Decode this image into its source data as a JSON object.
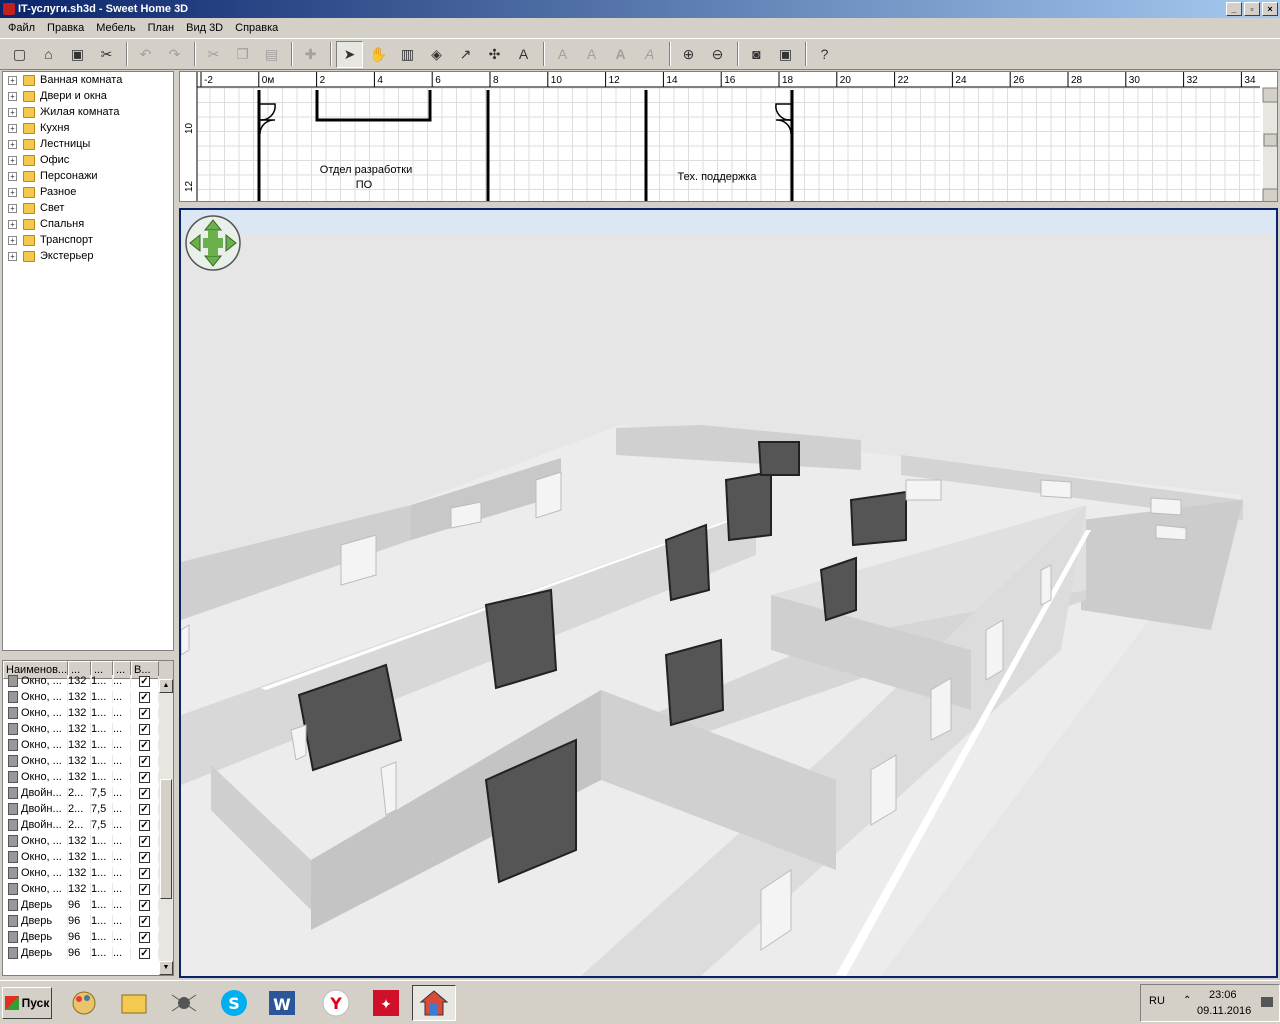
{
  "window": {
    "title": "IT-услуги.sh3d - Sweet Home 3D",
    "controls": [
      "_",
      "▫",
      "×"
    ]
  },
  "menu": [
    "Файл",
    "Правка",
    "Мебель",
    "План",
    "Вид 3D",
    "Справка"
  ],
  "catalog": [
    "Ванная комната",
    "Двери и окна",
    "Жилая комната",
    "Кухня",
    "Лестницы",
    "Офис",
    "Персонажи",
    "Разное",
    "Свет",
    "Спальня",
    "Транспорт",
    "Экстерьер"
  ],
  "furniture": {
    "headers": [
      "Наименов...",
      "...",
      "...",
      "...",
      "В..."
    ],
    "rows": [
      {
        "name": "Окно, ...",
        "w": "132",
        "d": "1...",
        "h": "...",
        "icon": "window-icon"
      },
      {
        "name": "Окно, ...",
        "w": "132",
        "d": "1...",
        "h": "...",
        "icon": "window-icon"
      },
      {
        "name": "Окно, ...",
        "w": "132",
        "d": "1...",
        "h": "...",
        "icon": "window-icon"
      },
      {
        "name": "Окно, ...",
        "w": "132",
        "d": "1...",
        "h": "...",
        "icon": "window-icon"
      },
      {
        "name": "Окно, ...",
        "w": "132",
        "d": "1...",
        "h": "...",
        "icon": "window-icon"
      },
      {
        "name": "Окно, ...",
        "w": "132",
        "d": "1...",
        "h": "...",
        "icon": "window-icon"
      },
      {
        "name": "Окно, ...",
        "w": "132",
        "d": "1...",
        "h": "...",
        "icon": "window-icon"
      },
      {
        "name": "Двойн...",
        "w": "2...",
        "d": "7,5",
        "h": "...",
        "icon": "double-door-icon"
      },
      {
        "name": "Двойн...",
        "w": "2...",
        "d": "7,5",
        "h": "...",
        "icon": "double-door-icon"
      },
      {
        "name": "Двойн...",
        "w": "2...",
        "d": "7,5",
        "h": "...",
        "icon": "double-door-icon"
      },
      {
        "name": "Окно, ...",
        "w": "132",
        "d": "1...",
        "h": "...",
        "icon": "window-icon"
      },
      {
        "name": "Окно, ...",
        "w": "132",
        "d": "1...",
        "h": "...",
        "icon": "window-icon"
      },
      {
        "name": "Окно, ...",
        "w": "132",
        "d": "1...",
        "h": "...",
        "icon": "window-icon"
      },
      {
        "name": "Окно, ...",
        "w": "132",
        "d": "1...",
        "h": "...",
        "icon": "window-icon"
      },
      {
        "name": "Дверь",
        "w": "96",
        "d": "1...",
        "h": "...",
        "icon": "door-icon"
      },
      {
        "name": "Дверь",
        "w": "96",
        "d": "1...",
        "h": "...",
        "icon": "door-icon"
      },
      {
        "name": "Дверь",
        "w": "96",
        "d": "1...",
        "h": "...",
        "icon": "door-icon"
      },
      {
        "name": "Дверь",
        "w": "96",
        "d": "1...",
        "h": "...",
        "icon": "door-icon"
      }
    ]
  },
  "plan": {
    "ruler_x": [
      "-2",
      "0м",
      "2",
      "4",
      "6",
      "8",
      "10",
      "12",
      "14",
      "16",
      "18",
      "20",
      "22",
      "24",
      "26",
      "28",
      "30",
      "32",
      "34"
    ],
    "ruler_y": [
      "10",
      "12"
    ],
    "rooms": [
      "Отдел разработки",
      "ПО",
      "Тех. поддержка"
    ]
  },
  "taskbar": {
    "start": "Пуск",
    "lang": "RU",
    "time": "23:06",
    "date": "09.11.2016"
  }
}
